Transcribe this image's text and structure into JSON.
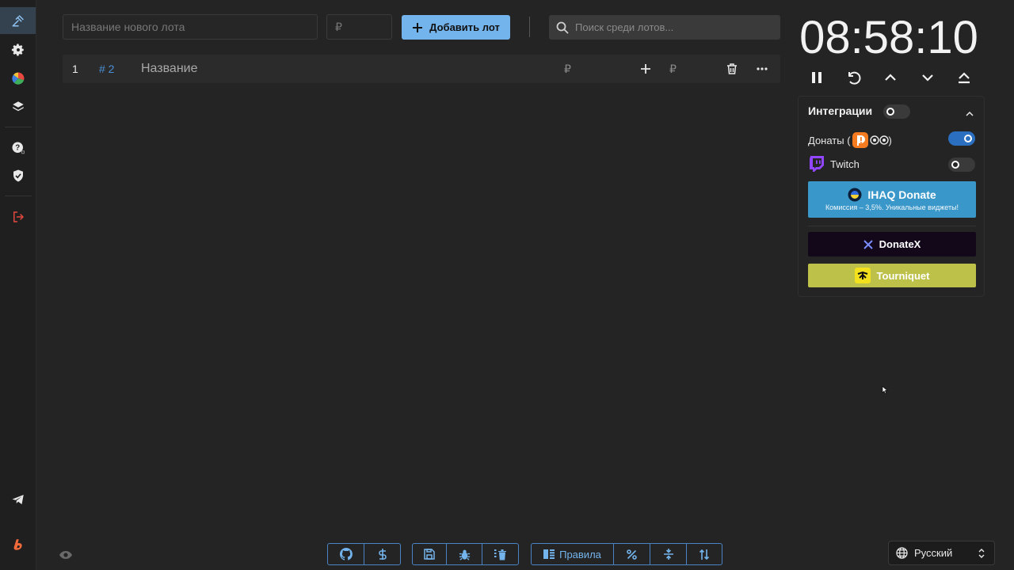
{
  "toolbar": {
    "new_lot_placeholder": "Название нового лота",
    "amount_placeholder": "₽",
    "add_lot_label": "Добавить лот",
    "search_placeholder": "Поиск среди лотов..."
  },
  "lots": [
    {
      "index": "1",
      "id": "# 2",
      "name": "Название",
      "amount_currency": "₽",
      "add_currency": "₽"
    }
  ],
  "timer": {
    "value": "08:58:10"
  },
  "integrations": {
    "title": "Интеграции",
    "enabled": false,
    "items": [
      {
        "label_prefix": "Донаты (",
        "label_suffix": ")",
        "enabled": true
      },
      {
        "label": "Twitch",
        "enabled": false
      }
    ],
    "services": [
      {
        "name": "IHAQ Donate",
        "subtitle": "Комиссия – 3,5%. Уникальные виджеты!",
        "color": "#3a97c9"
      },
      {
        "name": "DonateX",
        "color": "#12081a"
      },
      {
        "name": "Tourniquet",
        "color": "#bdc14a"
      }
    ]
  },
  "bottom_bar": {
    "rules_label": "Правила"
  },
  "language": {
    "selected": "Русский"
  },
  "colors": {
    "accent": "#74b4ec",
    "danger": "#e0483f",
    "background": "#242424"
  }
}
